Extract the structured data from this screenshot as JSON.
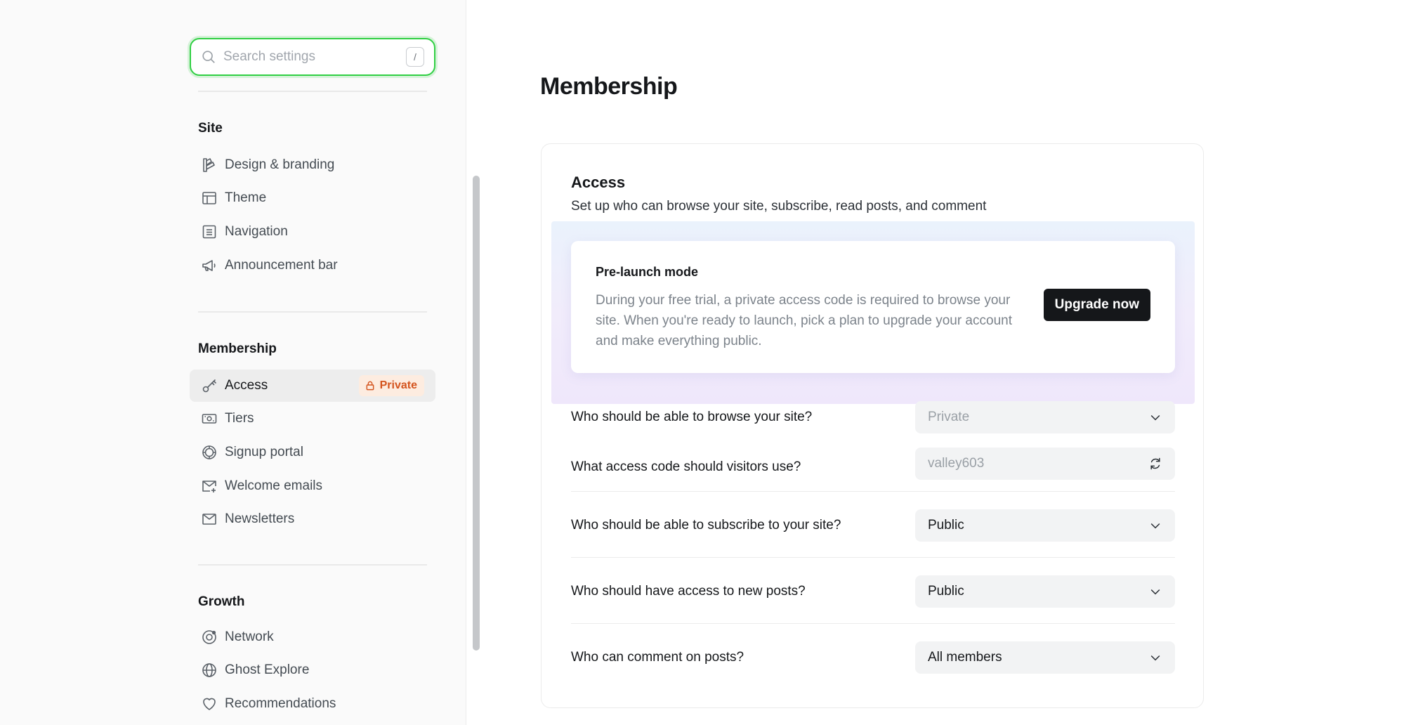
{
  "search": {
    "placeholder": "Search settings",
    "shortcut": "/"
  },
  "sidebar": {
    "groups": [
      {
        "title": "Site",
        "items": [
          {
            "label": "Design & branding",
            "icon": "paintbrush-icon"
          },
          {
            "label": "Theme",
            "icon": "layout-icon"
          },
          {
            "label": "Navigation",
            "icon": "list-icon"
          },
          {
            "label": "Announcement bar",
            "icon": "megaphone-icon"
          }
        ]
      },
      {
        "title": "Membership",
        "items": [
          {
            "label": "Access",
            "icon": "key-icon",
            "active": true,
            "badge": "Private"
          },
          {
            "label": "Tiers",
            "icon": "money-icon"
          },
          {
            "label": "Signup portal",
            "icon": "portal-icon"
          },
          {
            "label": "Welcome emails",
            "icon": "email-plus-icon"
          },
          {
            "label": "Newsletters",
            "icon": "email-icon"
          }
        ]
      },
      {
        "title": "Growth",
        "items": [
          {
            "label": "Network",
            "icon": "network-icon"
          },
          {
            "label": "Ghost Explore",
            "icon": "globe-icon"
          },
          {
            "label": "Recommendations",
            "icon": "heart-icon"
          }
        ]
      }
    ]
  },
  "main": {
    "title": "Membership",
    "access": {
      "title": "Access",
      "description": "Set up who can browse your site, subscribe, read posts, and comment",
      "prelaunch": {
        "title": "Pre-launch mode",
        "text": "During your free trial, a private access code is required to browse your site. When you're ready to launch, pick a plan to upgrade your account and make everything public.",
        "button": "Upgrade now"
      },
      "rows": [
        {
          "label": "Who should be able to browse your site?",
          "value": "Private",
          "disabled": true
        },
        {
          "label": "What access code should visitors use?",
          "value": "valley603",
          "disabled": true
        },
        {
          "label": "Who should be able to subscribe to your site?",
          "value": "Public"
        },
        {
          "label": "Who should have access to new posts?",
          "value": "Public"
        },
        {
          "label": "Who can comment on posts?",
          "value": "All members"
        }
      ]
    }
  },
  "colors": {
    "accent_focus": "#30cf43",
    "badge_text": "#d4541e",
    "badge_bg": "#fdece0",
    "button_bg": "#15171a"
  }
}
